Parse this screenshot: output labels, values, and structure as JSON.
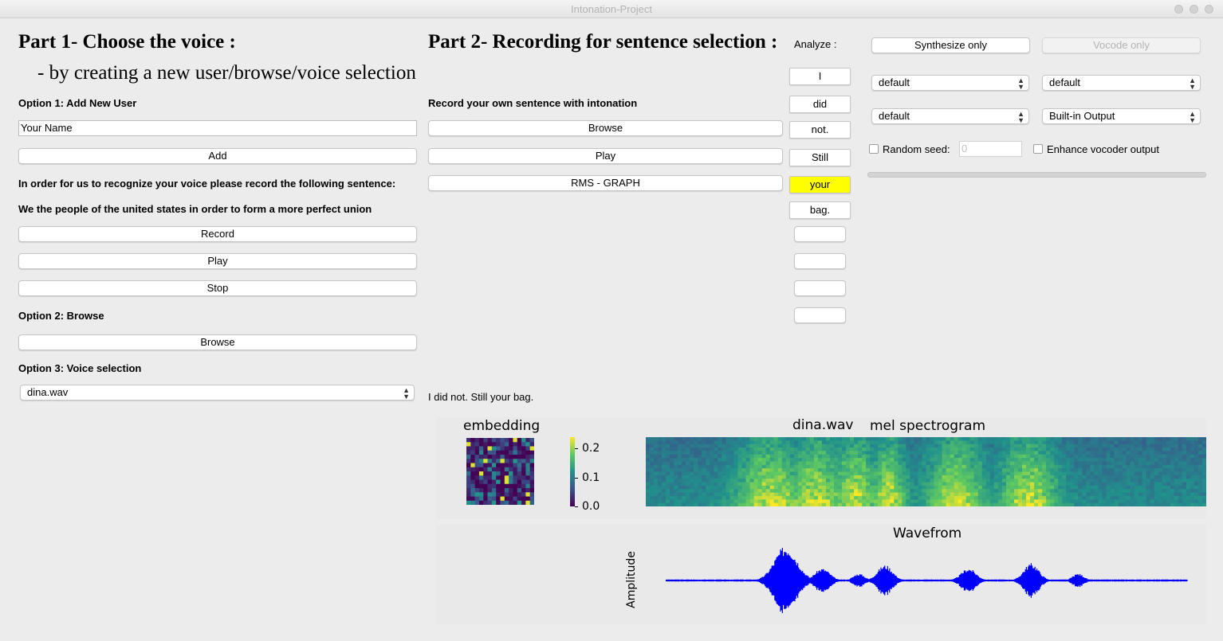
{
  "window": {
    "title": "Intonation-Project"
  },
  "part1": {
    "heading": "Part 1- Choose the voice :",
    "subheading": "- by creating a new user/browse/voice selection",
    "option1_label": "Option 1: Add New User",
    "name_value": "Your Name",
    "add_label": "Add",
    "instruction": "In order for us to recognize your voice please record the following sentence:",
    "sentence": "We the people of the united states in order to form a more perfect union",
    "record_label": "Record",
    "play_label": "Play",
    "stop_label": "Stop",
    "option2_label": "Option 2: Browse",
    "browse_label": "Browse",
    "option3_label": "Option 3: Voice selection",
    "voice_selected": "dina.wav"
  },
  "part2": {
    "heading": "Part 2- Recording for sentence selection :",
    "record_own_label": "Record your own sentence with intonation",
    "browse_label": "Browse",
    "play_label": "Play",
    "rms_label": "RMS - GRAPH",
    "sentence_text": "I did not. Still your bag."
  },
  "analyze": {
    "label": "Analyze :",
    "words": [
      "I",
      "did",
      "not.",
      "Still",
      "your",
      "bag."
    ],
    "highlight_index": 4,
    "highlight_color": "#ffff00"
  },
  "synth": {
    "synthesize_label": "Synthesize only",
    "vocode_label": "Vocode only",
    "dropdown1": "default",
    "dropdown2": "default",
    "dropdown3": "default",
    "dropdown4": "Built-in Output",
    "random_seed_label": "Random seed:",
    "random_seed_placeholder": "0",
    "enhance_label": "Enhance vocoder output"
  },
  "figures": {
    "embedding_title": "embedding",
    "colorbar_ticks": [
      "0.2",
      "0.1",
      "0.0"
    ],
    "spec_file": "dina.wav",
    "spec_title": "mel spectrogram",
    "wave_title": "Wavefrom",
    "wave_ylabel": "Amplitude",
    "colormap_low": "#440154",
    "colormap_high": "#fde725",
    "wave_color": "#0000ff"
  }
}
